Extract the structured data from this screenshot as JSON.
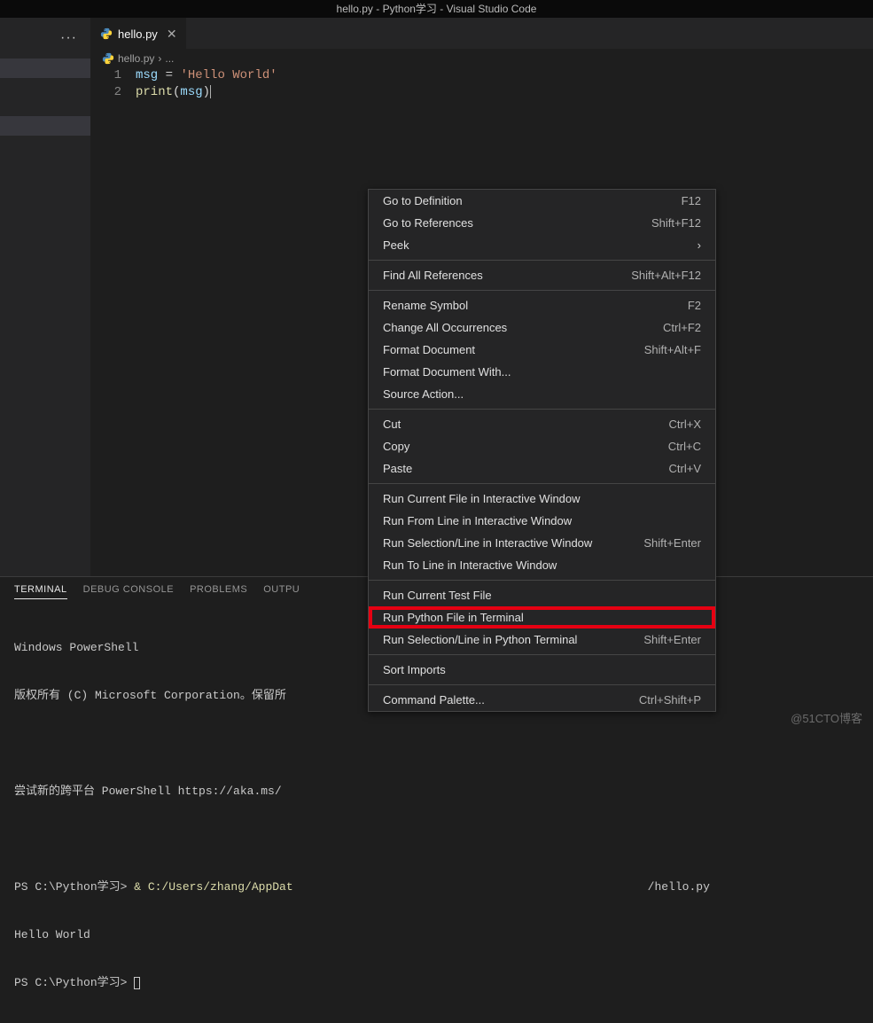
{
  "title": "hello.py - Python学习 - Visual Studio Code",
  "tab": {
    "filename": "hello.py",
    "close": "✕"
  },
  "breadcrumb": {
    "file": "hello.py",
    "sep": "›",
    "more": "..."
  },
  "code": {
    "line1": {
      "var": "msg",
      "op": " = ",
      "str": "'Hello World'"
    },
    "line2": {
      "fn": "print",
      "open": "(",
      "arg": "msg",
      "close": ")"
    },
    "gutter1": "1",
    "gutter2": "2"
  },
  "panel": {
    "tabs": {
      "terminal": "TERMINAL",
      "debug": "DEBUG CONSOLE",
      "problems": "PROBLEMS",
      "output": "OUTPU"
    }
  },
  "terminal": {
    "l1": "Windows PowerShell",
    "l2": "版权所有 (C) Microsoft Corporation。保留所",
    "l3a": "尝试新的跨平台 PowerShell ",
    "l3b": "https://aka.ms/",
    "l4a": "PS C:\\Python学习> ",
    "l4b": "& C:/Users/zhang/AppDat",
    "l4c": "/hello.py",
    "l5": "Hello World",
    "l6": "PS C:\\Python学习> "
  },
  "menu": {
    "goto_def": "Go to Definition",
    "goto_def_k": "F12",
    "goto_ref": "Go to References",
    "goto_ref_k": "Shift+F12",
    "peek": "Peek",
    "find_ref": "Find All References",
    "find_ref_k": "Shift+Alt+F12",
    "rename": "Rename Symbol",
    "rename_k": "F2",
    "change_all": "Change All Occurrences",
    "change_all_k": "Ctrl+F2",
    "format": "Format Document",
    "format_k": "Shift+Alt+F",
    "format_with": "Format Document With...",
    "source": "Source Action...",
    "cut": "Cut",
    "cut_k": "Ctrl+X",
    "copy": "Copy",
    "copy_k": "Ctrl+C",
    "paste": "Paste",
    "paste_k": "Ctrl+V",
    "run_interactive": "Run Current File in Interactive Window",
    "run_from_line": "Run From Line in Interactive Window",
    "run_sel_inter": "Run Selection/Line in Interactive Window",
    "run_sel_inter_k": "Shift+Enter",
    "run_to_line": "Run To Line in Interactive Window",
    "run_test": "Run Current Test File",
    "run_py_term": "Run Python File in Terminal",
    "run_sel_py": "Run Selection/Line in Python Terminal",
    "run_sel_py_k": "Shift+Enter",
    "sort": "Sort Imports",
    "palette": "Command Palette...",
    "palette_k": "Ctrl+Shift+P"
  },
  "watermark": "@51CTO博客"
}
